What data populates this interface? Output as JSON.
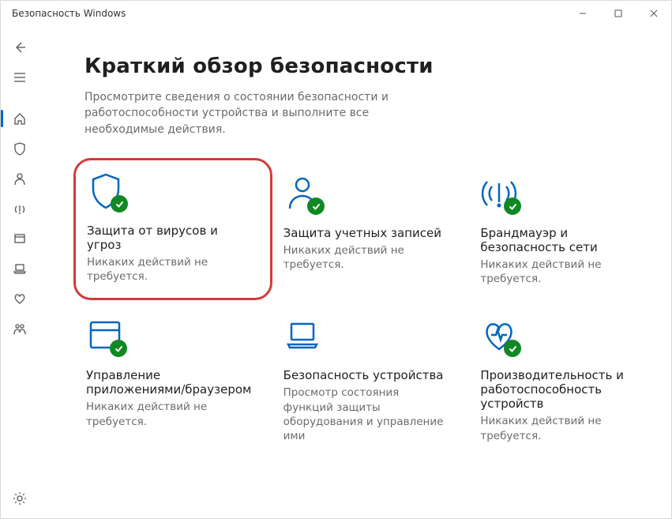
{
  "window": {
    "title": "Безопасность Windows"
  },
  "page": {
    "heading": "Краткий обзор безопасности",
    "subtitle": "Просмотрите сведения о состоянии безопасности и работоспособности устройства и выполните все необходимые действия."
  },
  "cards": [
    {
      "id": "virus",
      "title": "Защита от вирусов и угроз",
      "desc": "Никаких действий не требуется.",
      "icon": "shield",
      "highlighted": true
    },
    {
      "id": "account",
      "title": "Защита учетных записей",
      "desc": "Никаких действий не требуется.",
      "icon": "person",
      "highlighted": false
    },
    {
      "id": "firewall",
      "title": "Брандмауэр и безопасность сети",
      "desc": "Никаких действий не требуется.",
      "icon": "wifi",
      "highlighted": false
    },
    {
      "id": "appbrowser",
      "title": "Управление приложениями/браузером",
      "desc": "Никаких действий не требуется.",
      "icon": "window",
      "highlighted": false
    },
    {
      "id": "device",
      "title": "Безопасность устройства",
      "desc": "Просмотр состояния функций защиты оборудования и управление ими",
      "icon": "laptop",
      "highlighted": false
    },
    {
      "id": "performance",
      "title": "Производительность и работоспособность устройств",
      "desc": "Никаких действий не требуется.",
      "icon": "heart",
      "highlighted": false
    }
  ],
  "sidebar": {
    "items": [
      {
        "id": "menu",
        "icon": "menu"
      },
      {
        "id": "home",
        "icon": "home",
        "selected": true
      },
      {
        "id": "shield",
        "icon": "shield-o"
      },
      {
        "id": "person",
        "icon": "person-o"
      },
      {
        "id": "wifi",
        "icon": "wifi-o"
      },
      {
        "id": "window",
        "icon": "window-o"
      },
      {
        "id": "laptop",
        "icon": "laptop-o"
      },
      {
        "id": "heart",
        "icon": "heart-o"
      },
      {
        "id": "family",
        "icon": "family-o"
      }
    ],
    "settings": {
      "icon": "gear"
    }
  }
}
